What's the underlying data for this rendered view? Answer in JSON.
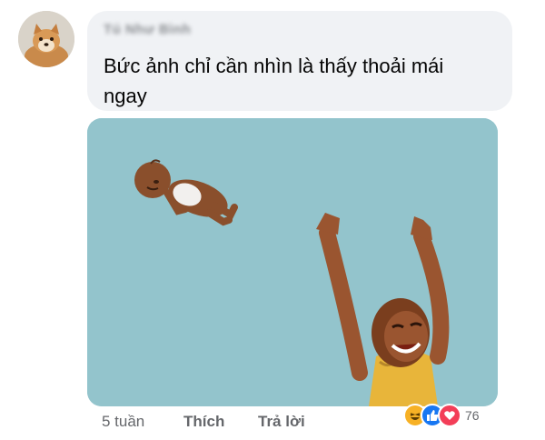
{
  "comment": {
    "author": "Tú Như Bình",
    "text": "Bức ảnh chỉ cần nhìn là thấy thoải mái ngay"
  },
  "footer": {
    "time": "5 tuần",
    "like_label": "Thích",
    "reply_label": "Trả lời"
  },
  "reactions": {
    "icons": [
      "haha-icon",
      "like-icon",
      "love-icon"
    ],
    "count": "76"
  },
  "colors": {
    "bubble": "#f0f2f5",
    "sky": "#93c4cc",
    "like_blue": "#1877f2",
    "love_red": "#f33e58",
    "haha_yellow": "#f7b125"
  }
}
